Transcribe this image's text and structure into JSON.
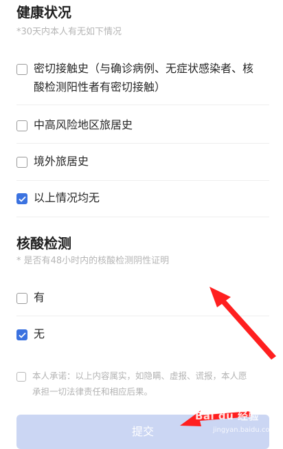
{
  "health": {
    "title": "健康状况",
    "hint": "*30天内本人有无如下情况",
    "options": [
      {
        "label_line1": "密切接触史（与确诊病例、无症状感染者、核",
        "label_line2": "酸检测阳性者有密切接触）",
        "checked": false
      },
      {
        "label": "中高风险地区旅居史",
        "checked": false
      },
      {
        "label": "境外旅居史",
        "checked": false
      },
      {
        "label": "以上情况均无",
        "checked": true
      }
    ]
  },
  "nucleic": {
    "title": "核酸检测",
    "hint": "* 是否有48小时内的核酸检测阴性证明",
    "options": [
      {
        "label": "有",
        "checked": false
      },
      {
        "label": "无",
        "checked": true
      }
    ]
  },
  "pledge": {
    "line1": "本人承诺：以上内容属实，如隐瞒、虚报、谎报，本人愿",
    "line2": "承担一切法律责任和相应后果。",
    "checked": false
  },
  "submit_label": "提交",
  "watermark": {
    "brand": "Bai du 经验",
    "url": "jingyan.baidu.com"
  },
  "colors": {
    "accent": "#3b72e0",
    "arrow": "#ff1f1f",
    "submit_bg": "#cbd6f3"
  }
}
